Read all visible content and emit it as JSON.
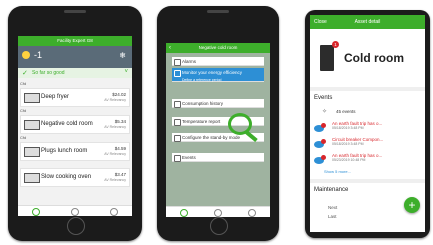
{
  "phone1": {
    "header_title": "Facility Expert G8",
    "weather_temp": "-1",
    "status": "So far so good",
    "section_labels": [
      "Cfd",
      "Cfd",
      "Cfd"
    ],
    "rows": [
      {
        "label": "Deep fryer",
        "value": "$24.02",
        "sub": "AV Relevancy"
      },
      {
        "label": "Negative cold room",
        "value": "$5.34",
        "sub": "AV Relevancy"
      },
      {
        "label": "Plugs lunch room",
        "value": "$4.59",
        "sub": "AV Relevancy"
      },
      {
        "label": "Slow cooking oven",
        "value": "$3.47",
        "sub": "AV Relevancy"
      }
    ]
  },
  "phone2": {
    "header_title": "Negative cold room",
    "menu": [
      {
        "label": "Alarms"
      },
      {
        "label": "Monitor your energy efficiency",
        "sub": "Define a reference period"
      },
      {
        "label": "Consumption history"
      },
      {
        "label": "Temperature report"
      },
      {
        "label": "Configure the stand-by mode"
      },
      {
        "label": "Events"
      }
    ]
  },
  "phone3": {
    "close_label": "Close",
    "header_title": "Asset detail",
    "asset_title": "Cold room",
    "badge": "1",
    "events_title": "Events",
    "events_count": "45 events",
    "events": [
      {
        "title": "An earth fault trip has o...",
        "date": "05/18/2019 3:48 PM"
      },
      {
        "title": "Circuit breaker Compon...",
        "date": "05/18/2019 3:48 PM"
      },
      {
        "title": "An earth fault trip has o...",
        "date": "05/23/2019 10:48 PM"
      }
    ],
    "show_more": "Show 5 more...",
    "maintenance_title": "Maintenance",
    "maint_next": "Next",
    "maint_last": "Last",
    "fab_label": "+"
  },
  "colors": {
    "accent": "#3dae2b",
    "alert": "#d8262b",
    "event_icon": "#2d8fd5"
  }
}
